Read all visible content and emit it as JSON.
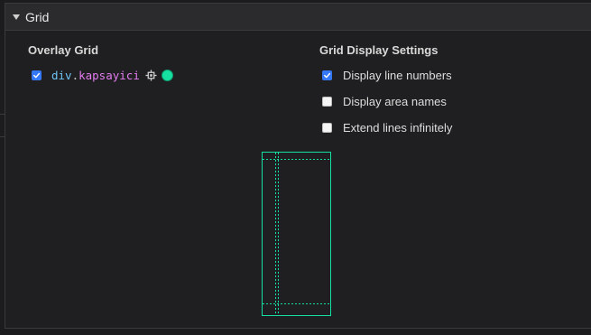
{
  "section": {
    "title": "Grid",
    "expanded": true
  },
  "overlay_grid": {
    "heading": "Overlay Grid",
    "items": [
      {
        "checked": true,
        "tag": "div",
        "separator": ".",
        "class_name": "kapsayici",
        "icon": "target-icon",
        "color": "#16e0a1"
      }
    ]
  },
  "display_settings": {
    "heading": "Grid Display Settings",
    "options": [
      {
        "label": "Display line numbers",
        "checked": true
      },
      {
        "label": "Display area names",
        "checked": false
      },
      {
        "label": "Extend lines infinitely",
        "checked": false
      }
    ]
  },
  "preview": {
    "color": "#16e0a1"
  },
  "colors": {
    "background": "#1f1f21",
    "header": "#2b2b2d",
    "checkbox_on": "#3478f6",
    "tag": "#6fc3f4",
    "class_name": "#e37cf0"
  }
}
